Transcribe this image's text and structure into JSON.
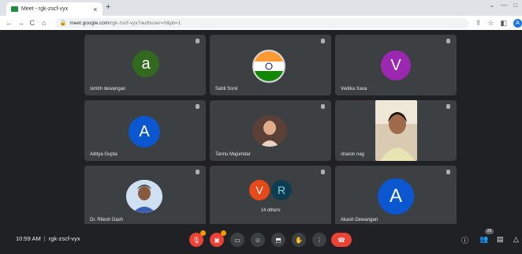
{
  "browser": {
    "tab_title": "Meet - rgk-zscf-vyx",
    "tab_close": "×",
    "new_tab": "+",
    "window_controls": [
      "⌄",
      "—",
      "□"
    ],
    "url_host": "meet.google.com",
    "url_path": "/rgk-zscf-vyx?authuser=0&pli=1",
    "nav_icons": [
      "←",
      "→",
      "C",
      "⌂"
    ],
    "profile_initial": "A"
  },
  "tiles": [
    {
      "name": "simbh dewangan",
      "avatar_letter": "a",
      "avatar_color": "#33691e"
    },
    {
      "name": "Sahil Sonii",
      "avatar_type": "flag"
    },
    {
      "name": "Vedika Xaxa",
      "avatar_letter": "V",
      "avatar_color": "#9c27b0"
    },
    {
      "name": "Aditya Gupta",
      "avatar_letter": "A",
      "avatar_color": "#0b57d0"
    },
    {
      "name": "Tannu Majumdar",
      "avatar_type": "photo"
    },
    {
      "name": "sharon nag",
      "avatar_type": "video"
    },
    {
      "name": "Dr. Ritesh Dash",
      "avatar_type": "photo"
    },
    {
      "name": "",
      "others_label": "14 others",
      "avatar_letter": "V",
      "avatar_color": "#e64a19",
      "second_letter": "R"
    },
    {
      "name": "Akash Dewangan",
      "avatar_letter": "A",
      "avatar_color": "#0b57d0"
    }
  ],
  "bottom": {
    "time": "10:59 AM",
    "meeting_code": "rgk-zscf-vyx",
    "participant_count": "20"
  },
  "colors": {
    "meet_bg": "#202124",
    "tile_bg": "#3c4043",
    "end_call": "#ea4335"
  }
}
